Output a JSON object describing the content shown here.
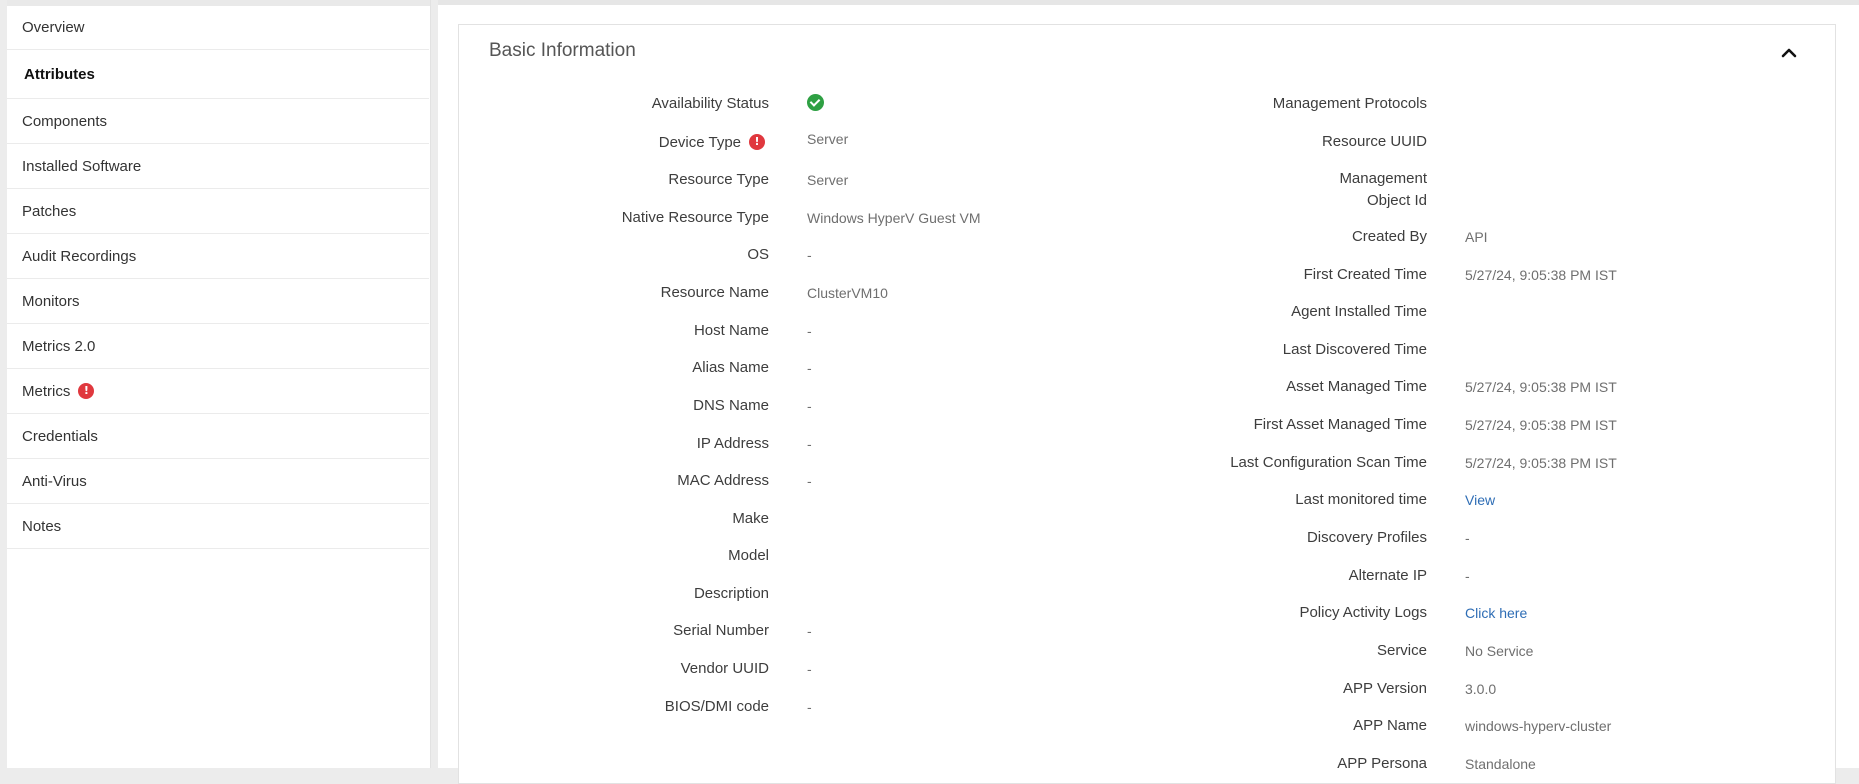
{
  "sidebar": {
    "items": [
      {
        "label": "Overview"
      },
      {
        "label": "Attributes"
      },
      {
        "label": "Components"
      },
      {
        "label": "Installed Software"
      },
      {
        "label": "Patches"
      },
      {
        "label": "Audit Recordings"
      },
      {
        "label": "Monitors"
      },
      {
        "label": "Metrics 2.0"
      },
      {
        "label": "Metrics"
      },
      {
        "label": "Credentials"
      },
      {
        "label": "Anti-Virus"
      },
      {
        "label": "Notes"
      }
    ],
    "alert_glyph": "!"
  },
  "card": {
    "title": "Basic Information"
  },
  "left_fields": [
    {
      "label": "Availability Status",
      "value": ""
    },
    {
      "label": "Device Type",
      "value": "Server"
    },
    {
      "label": "Resource Type",
      "value": "Server"
    },
    {
      "label": "Native Resource Type",
      "value": "Windows HyperV Guest VM"
    },
    {
      "label": "OS",
      "value": "-"
    },
    {
      "label": "Resource Name",
      "value": "ClusterVM10"
    },
    {
      "label": "Host Name",
      "value": "-"
    },
    {
      "label": "Alias Name",
      "value": "-"
    },
    {
      "label": "DNS Name",
      "value": "-"
    },
    {
      "label": "IP Address",
      "value": "-"
    },
    {
      "label": "MAC Address",
      "value": "-"
    },
    {
      "label": "Make",
      "value": ""
    },
    {
      "label": "Model",
      "value": ""
    },
    {
      "label": "Description",
      "value": ""
    },
    {
      "label": "Serial Number",
      "value": "-"
    },
    {
      "label": "Vendor UUID",
      "value": "-"
    },
    {
      "label": "BIOS/DMI code",
      "value": "-"
    }
  ],
  "right_fields": [
    {
      "label": "Management Protocols",
      "value": ""
    },
    {
      "label": "Resource UUID",
      "value": ""
    },
    {
      "label_line1": "Management",
      "label_line2": "Object Id",
      "value": ""
    },
    {
      "label": "Created By",
      "value": "API"
    },
    {
      "label": "First Created Time",
      "value": "5/27/24, 9:05:38 PM IST"
    },
    {
      "label": "Agent Installed Time",
      "value": ""
    },
    {
      "label": "Last Discovered Time",
      "value": ""
    },
    {
      "label": "Asset Managed Time",
      "value": "5/27/24, 9:05:38 PM IST"
    },
    {
      "label": "First Asset Managed Time",
      "value": "5/27/24, 9:05:38 PM IST"
    },
    {
      "label": "Last Configuration Scan Time",
      "value": "5/27/24, 9:05:38 PM IST"
    },
    {
      "label": "Last monitored time",
      "value": "View"
    },
    {
      "label": "Discovery Profiles",
      "value": "-"
    },
    {
      "label": "Alternate IP",
      "value": "-"
    },
    {
      "label": "Policy Activity Logs",
      "value": "Click here"
    },
    {
      "label": "Service",
      "value": "No Service"
    },
    {
      "label": "APP Version",
      "value": "3.0.0"
    },
    {
      "label": "APP Name",
      "value": "windows-hyperv-cluster"
    },
    {
      "label": "APP Persona",
      "value": "Standalone"
    }
  ],
  "colors": {
    "link": "#2e6db5",
    "status_ok": "#2ea043",
    "alert": "#e0383e"
  }
}
